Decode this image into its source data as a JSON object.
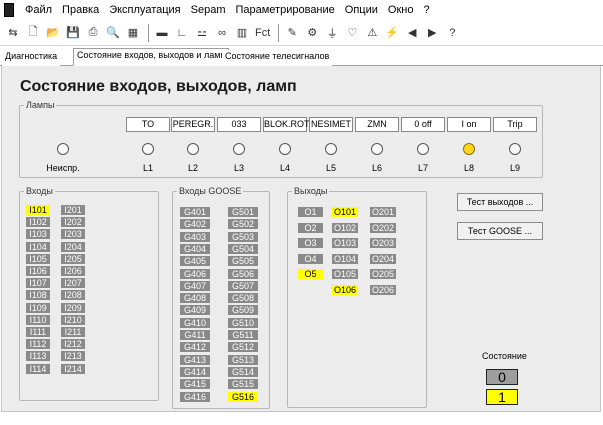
{
  "menu": [
    "Файл",
    "Правка",
    "Эксплуатация",
    "Sepam",
    "Параметрирование",
    "Опции",
    "Окно",
    "?"
  ],
  "toolbar": {
    "fct_label": "Fct"
  },
  "tabs": [
    "Диагностика",
    "Состояние входов, выходов и ламп",
    "Состояние телесигналов"
  ],
  "active_tab": 1,
  "title": "Состояние входов, выходов, ламп",
  "lamps": {
    "legend": "Лампы",
    "labels": [
      "TO",
      "PEREGR.",
      "033",
      "BLOK.ROT",
      "NESIMET",
      "ZMN",
      "0 off",
      "I on",
      "Trip"
    ],
    "nums": [
      "Неиспр.",
      "L1",
      "L2",
      "L3",
      "L4",
      "L5",
      "L6",
      "L7",
      "L8",
      "L9"
    ],
    "on": [
      false,
      false,
      false,
      false,
      false,
      false,
      false,
      false,
      true,
      false
    ]
  },
  "inputs": {
    "legend": "Входы",
    "col1": [
      "I101",
      "I102",
      "I103",
      "I104",
      "I105",
      "I106",
      "I107",
      "I108",
      "I109",
      "I110",
      "I111",
      "I112",
      "I113",
      "I114"
    ],
    "col2": [
      "I201",
      "I202",
      "I203",
      "I204",
      "I205",
      "I206",
      "I207",
      "I208",
      "I209",
      "I210",
      "I211",
      "I212",
      "I213",
      "I214"
    ],
    "on": [
      "I101"
    ]
  },
  "goose": {
    "legend": "Входы GOOSE",
    "col1": [
      "G401",
      "G402",
      "G403",
      "G404",
      "G405",
      "G406",
      "G407",
      "G408",
      "G409",
      "G410",
      "G411",
      "G412",
      "G413",
      "G414",
      "G415",
      "G416"
    ],
    "col2": [
      "G501",
      "G502",
      "G503",
      "G504",
      "G505",
      "G506",
      "G507",
      "G508",
      "G509",
      "G510",
      "G511",
      "G512",
      "G513",
      "G514",
      "G515",
      "G516"
    ],
    "on": [
      "G516"
    ]
  },
  "outputs": {
    "legend": "Выходы",
    "col1": [
      "O1",
      "O2",
      "O3",
      "O4",
      "O5"
    ],
    "col2": [
      "O101",
      "O102",
      "O103",
      "O104",
      "O105",
      "O106"
    ],
    "col3": [
      "O201",
      "O202",
      "O203",
      "O204",
      "O205",
      "O206"
    ],
    "on": [
      "O5",
      "O101",
      "O106"
    ]
  },
  "buttons": {
    "test_outputs": "Тест выходов ...",
    "test_goose": "Тест GOOSE ..."
  },
  "state": {
    "label": "Состояние",
    "val0": "0",
    "val1": "1"
  },
  "colors": {
    "on": "#ffff00",
    "off": "#8a8a8a",
    "lamp_on": "#ffd71f"
  }
}
